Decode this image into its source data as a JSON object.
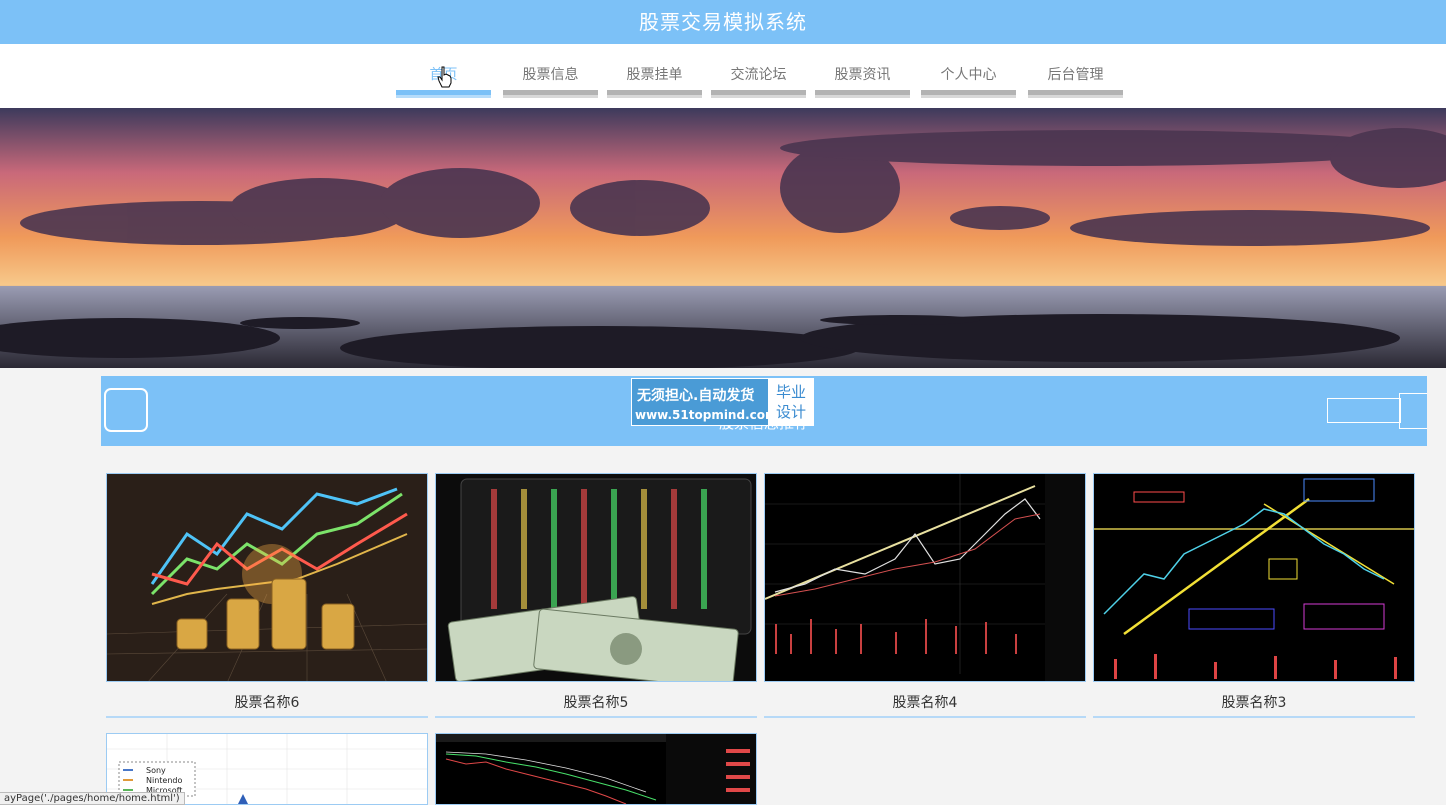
{
  "app": {
    "title": "股票交易模拟系统"
  },
  "nav": {
    "items": [
      {
        "label": "首页",
        "active": true
      },
      {
        "label": "股票信息",
        "active": false
      },
      {
        "label": "股票挂单",
        "active": false
      },
      {
        "label": "交流论坛",
        "active": false
      },
      {
        "label": "股票资讯",
        "active": false
      },
      {
        "label": "个人中心",
        "active": false
      },
      {
        "label": "后台管理",
        "active": false
      }
    ]
  },
  "section": {
    "title": "股票信息推荐"
  },
  "watermark": {
    "main": "无须担心.自动发货",
    "url": "www.51topmind.com",
    "side_line1": "毕业",
    "side_line2": "设计"
  },
  "cards": [
    {
      "name": "股票名称6"
    },
    {
      "name": "股票名称5"
    },
    {
      "name": "股票名称4"
    },
    {
      "name": "股票名称3"
    }
  ],
  "legend_items": [
    "Sony",
    "Nintendo",
    "Microsoft"
  ],
  "status_bar": {
    "text": "ayPage('./pages/home/home.html')"
  },
  "colors": {
    "accent": "#7cc1f7",
    "nav_inactive": "#b3b3b3"
  }
}
